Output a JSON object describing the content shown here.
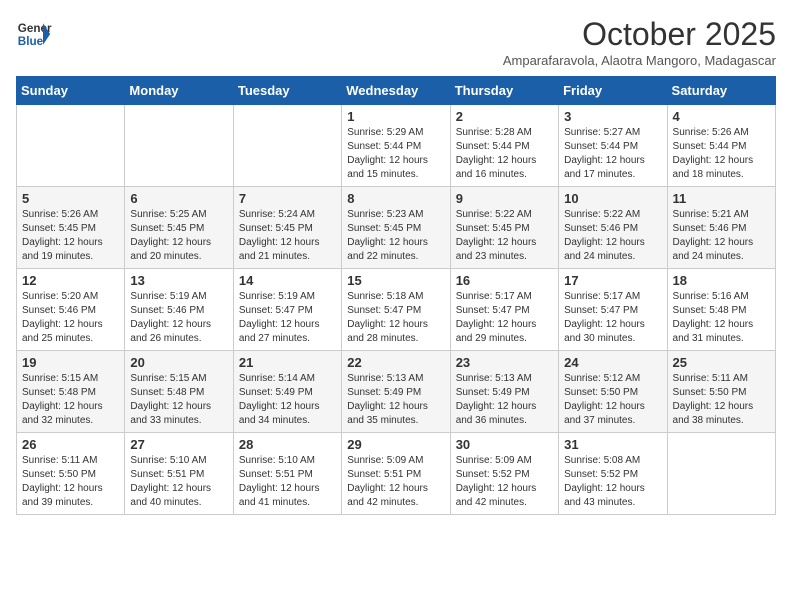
{
  "logo": {
    "line1": "General",
    "line2": "Blue"
  },
  "title": "October 2025",
  "subtitle": "Amparafaravola, Alaotra Mangoro, Madagascar",
  "days_of_week": [
    "Sunday",
    "Monday",
    "Tuesday",
    "Wednesday",
    "Thursday",
    "Friday",
    "Saturday"
  ],
  "weeks": [
    [
      {
        "day": "",
        "info": ""
      },
      {
        "day": "",
        "info": ""
      },
      {
        "day": "",
        "info": ""
      },
      {
        "day": "1",
        "info": "Sunrise: 5:29 AM\nSunset: 5:44 PM\nDaylight: 12 hours\nand 15 minutes."
      },
      {
        "day": "2",
        "info": "Sunrise: 5:28 AM\nSunset: 5:44 PM\nDaylight: 12 hours\nand 16 minutes."
      },
      {
        "day": "3",
        "info": "Sunrise: 5:27 AM\nSunset: 5:44 PM\nDaylight: 12 hours\nand 17 minutes."
      },
      {
        "day": "4",
        "info": "Sunrise: 5:26 AM\nSunset: 5:44 PM\nDaylight: 12 hours\nand 18 minutes."
      }
    ],
    [
      {
        "day": "5",
        "info": "Sunrise: 5:26 AM\nSunset: 5:45 PM\nDaylight: 12 hours\nand 19 minutes."
      },
      {
        "day": "6",
        "info": "Sunrise: 5:25 AM\nSunset: 5:45 PM\nDaylight: 12 hours\nand 20 minutes."
      },
      {
        "day": "7",
        "info": "Sunrise: 5:24 AM\nSunset: 5:45 PM\nDaylight: 12 hours\nand 21 minutes."
      },
      {
        "day": "8",
        "info": "Sunrise: 5:23 AM\nSunset: 5:45 PM\nDaylight: 12 hours\nand 22 minutes."
      },
      {
        "day": "9",
        "info": "Sunrise: 5:22 AM\nSunset: 5:45 PM\nDaylight: 12 hours\nand 23 minutes."
      },
      {
        "day": "10",
        "info": "Sunrise: 5:22 AM\nSunset: 5:46 PM\nDaylight: 12 hours\nand 24 minutes."
      },
      {
        "day": "11",
        "info": "Sunrise: 5:21 AM\nSunset: 5:46 PM\nDaylight: 12 hours\nand 24 minutes."
      }
    ],
    [
      {
        "day": "12",
        "info": "Sunrise: 5:20 AM\nSunset: 5:46 PM\nDaylight: 12 hours\nand 25 minutes."
      },
      {
        "day": "13",
        "info": "Sunrise: 5:19 AM\nSunset: 5:46 PM\nDaylight: 12 hours\nand 26 minutes."
      },
      {
        "day": "14",
        "info": "Sunrise: 5:19 AM\nSunset: 5:47 PM\nDaylight: 12 hours\nand 27 minutes."
      },
      {
        "day": "15",
        "info": "Sunrise: 5:18 AM\nSunset: 5:47 PM\nDaylight: 12 hours\nand 28 minutes."
      },
      {
        "day": "16",
        "info": "Sunrise: 5:17 AM\nSunset: 5:47 PM\nDaylight: 12 hours\nand 29 minutes."
      },
      {
        "day": "17",
        "info": "Sunrise: 5:17 AM\nSunset: 5:47 PM\nDaylight: 12 hours\nand 30 minutes."
      },
      {
        "day": "18",
        "info": "Sunrise: 5:16 AM\nSunset: 5:48 PM\nDaylight: 12 hours\nand 31 minutes."
      }
    ],
    [
      {
        "day": "19",
        "info": "Sunrise: 5:15 AM\nSunset: 5:48 PM\nDaylight: 12 hours\nand 32 minutes."
      },
      {
        "day": "20",
        "info": "Sunrise: 5:15 AM\nSunset: 5:48 PM\nDaylight: 12 hours\nand 33 minutes."
      },
      {
        "day": "21",
        "info": "Sunrise: 5:14 AM\nSunset: 5:49 PM\nDaylight: 12 hours\nand 34 minutes."
      },
      {
        "day": "22",
        "info": "Sunrise: 5:13 AM\nSunset: 5:49 PM\nDaylight: 12 hours\nand 35 minutes."
      },
      {
        "day": "23",
        "info": "Sunrise: 5:13 AM\nSunset: 5:49 PM\nDaylight: 12 hours\nand 36 minutes."
      },
      {
        "day": "24",
        "info": "Sunrise: 5:12 AM\nSunset: 5:50 PM\nDaylight: 12 hours\nand 37 minutes."
      },
      {
        "day": "25",
        "info": "Sunrise: 5:11 AM\nSunset: 5:50 PM\nDaylight: 12 hours\nand 38 minutes."
      }
    ],
    [
      {
        "day": "26",
        "info": "Sunrise: 5:11 AM\nSunset: 5:50 PM\nDaylight: 12 hours\nand 39 minutes."
      },
      {
        "day": "27",
        "info": "Sunrise: 5:10 AM\nSunset: 5:51 PM\nDaylight: 12 hours\nand 40 minutes."
      },
      {
        "day": "28",
        "info": "Sunrise: 5:10 AM\nSunset: 5:51 PM\nDaylight: 12 hours\nand 41 minutes."
      },
      {
        "day": "29",
        "info": "Sunrise: 5:09 AM\nSunset: 5:51 PM\nDaylight: 12 hours\nand 42 minutes."
      },
      {
        "day": "30",
        "info": "Sunrise: 5:09 AM\nSunset: 5:52 PM\nDaylight: 12 hours\nand 42 minutes."
      },
      {
        "day": "31",
        "info": "Sunrise: 5:08 AM\nSunset: 5:52 PM\nDaylight: 12 hours\nand 43 minutes."
      },
      {
        "day": "",
        "info": ""
      }
    ]
  ]
}
